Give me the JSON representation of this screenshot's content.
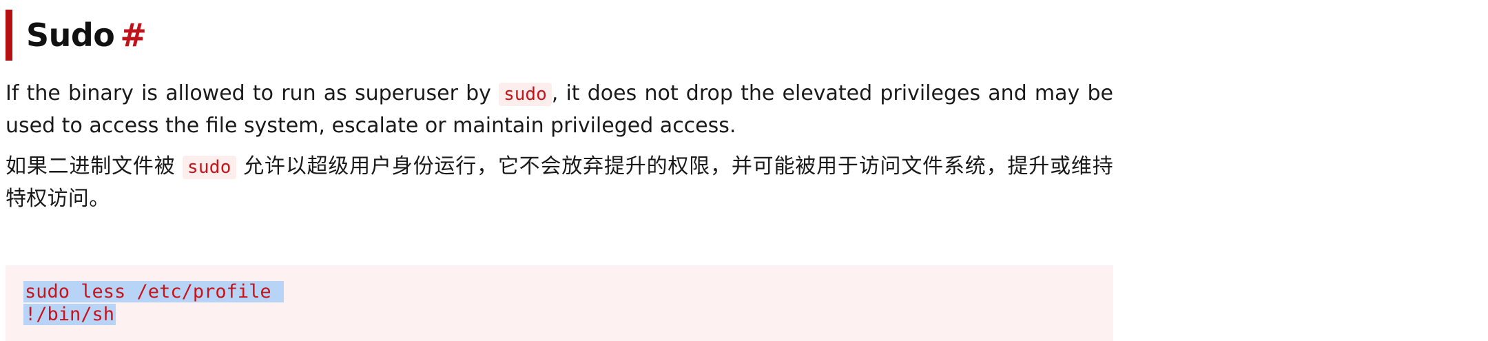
{
  "section": {
    "title": "Sudo",
    "anchor": "#"
  },
  "paragraph_en": {
    "before": "If the binary is allowed to run as superuser by ",
    "code": "sudo",
    "after": ", it does not drop the elevated privileges and may be used to access the file system, escalate or maintain privileged access."
  },
  "paragraph_zh": {
    "before": "如果二进制文件被 ",
    "code": "sudo",
    "after": " 允许以超级用户身份运行，它不会放弃提升的权限，并可能被用于访问文件系统，提升或维持特权访问。"
  },
  "code_block": {
    "lines": [
      "sudo less /etc/profile ",
      "!/bin/sh"
    ]
  },
  "colors": {
    "accent": "#b50f12",
    "code_text": "#c7141a",
    "code_background": "#fdf1f1",
    "selection": "#b7d3f5"
  }
}
